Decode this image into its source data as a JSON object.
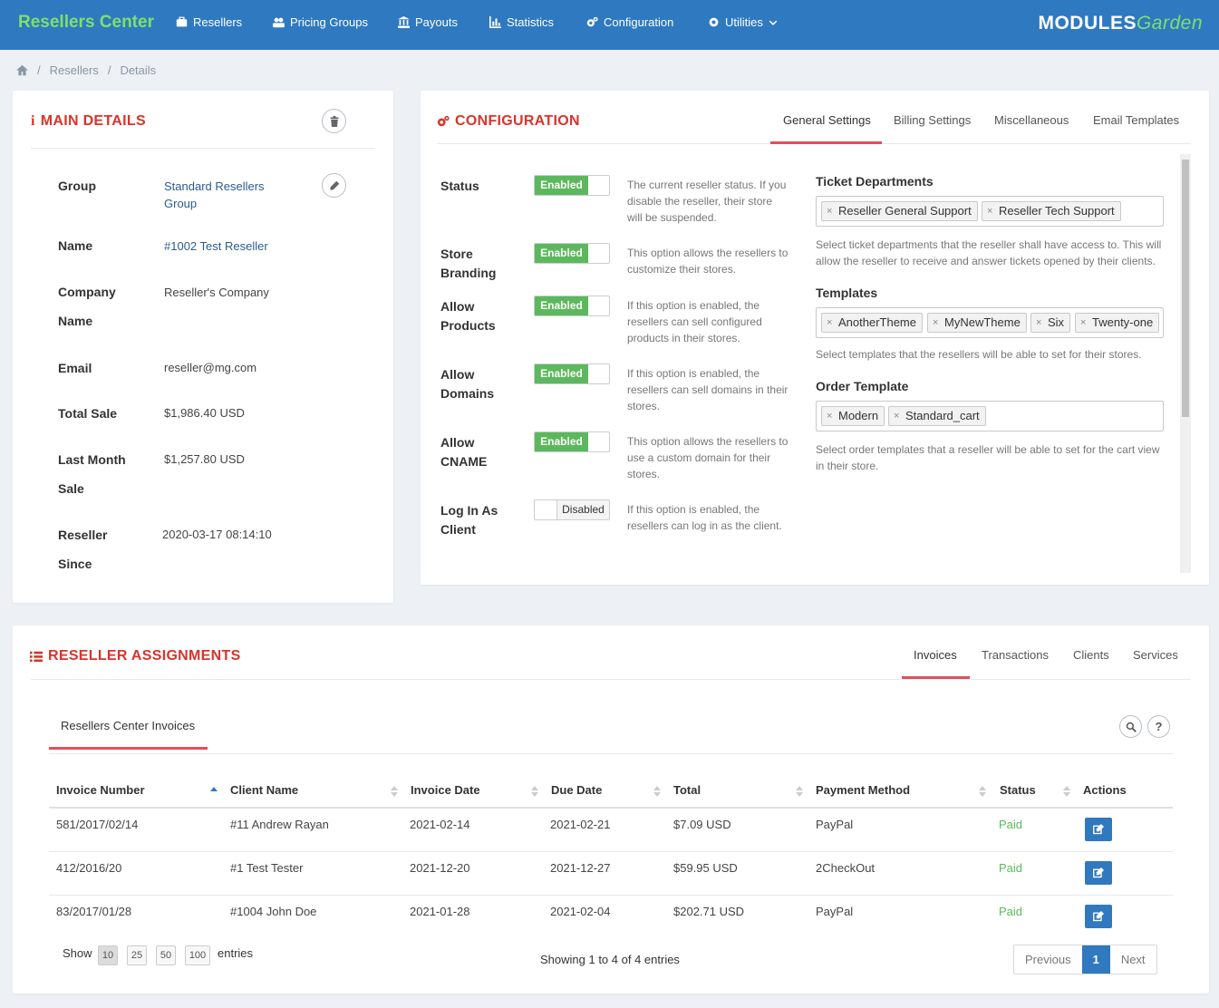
{
  "nav": {
    "brand": "Resellers Center",
    "items": [
      {
        "label": "Resellers",
        "icon": "briefcase-icon"
      },
      {
        "label": "Pricing Groups",
        "icon": "users-icon"
      },
      {
        "label": "Payouts",
        "icon": "bank-icon"
      },
      {
        "label": "Statistics",
        "icon": "bar-chart-icon"
      },
      {
        "label": "Configuration",
        "icon": "gears-icon"
      },
      {
        "label": "Utilities",
        "icon": "gear-icon"
      }
    ],
    "logo_left": "MODULES",
    "logo_right": "Garden"
  },
  "breadcrumb": [
    "Resellers",
    "Details"
  ],
  "main_details": {
    "title": "MAIN DETAILS",
    "fields": [
      {
        "label": "Group",
        "value": "Standard Resellers Group"
      },
      {
        "label": "Name",
        "value": "#1002 Test Reseller"
      },
      {
        "label": "Company Name",
        "value": "Reseller's Company"
      },
      {
        "label": "Email",
        "value": "reseller@mg.com"
      },
      {
        "label": "Total Sale",
        "value": "$1,986.40 USD"
      },
      {
        "label": "Last Month Sale",
        "value": "$1,257.80 USD"
      },
      {
        "label": "Reseller Since",
        "value": "2020-03-17 08:14:10"
      }
    ]
  },
  "configuration": {
    "title": "CONFIGURATION",
    "tabs": [
      "General Settings",
      "Billing Settings",
      "Miscellaneous",
      "Email Templates"
    ],
    "active_tab": "General Settings",
    "options": [
      {
        "label": "Status",
        "state": "Enabled",
        "description": "The current reseller status. If you disable the reseller, their store will be suspended."
      },
      {
        "label": "Store Branding",
        "state": "Enabled",
        "description": "This option allows the resellers to customize their stores."
      },
      {
        "label": "Allow Products",
        "state": "Enabled",
        "description": "If this option is enabled, the resellers can sell configured products in their stores."
      },
      {
        "label": "Allow Domains",
        "state": "Enabled",
        "description": "If this option is enabled, the resellers can sell domains in their stores."
      },
      {
        "label": "Allow CNAME",
        "state": "Enabled",
        "description": "This option allows the resellers to use a custom domain for their stores."
      },
      {
        "label": "Log In As Client",
        "state": "Disabled",
        "description": "If this option is enabled, the resellers can log in as the client."
      }
    ],
    "ticket_departments": {
      "heading": "Ticket Departments",
      "tags": [
        "Reseller General Support",
        "Reseller Tech Support"
      ],
      "help": "Select ticket departments that the reseller shall have access to. This will allow the reseller to receive and answer tickets opened by their clients."
    },
    "templates": {
      "heading": "Templates",
      "tags": [
        "AnotherTheme",
        "MyNewTheme",
        "Six",
        "Twenty-one"
      ],
      "help": "Select templates that the resellers will be able to set for their stores."
    },
    "order_template": {
      "heading": "Order Template",
      "tags": [
        "Modern",
        "Standard_cart"
      ],
      "help": "Select order templates that a reseller will be able to set for the cart view in their store."
    }
  },
  "assignments": {
    "title": "RESELLER ASSIGNMENTS",
    "tabs": [
      "Invoices",
      "Transactions",
      "Clients",
      "Services"
    ],
    "active_tab": "Invoices",
    "subtab": "Resellers Center Invoices",
    "columns": [
      "Invoice Number",
      "Client Name",
      "Invoice Date",
      "Due Date",
      "Total",
      "Payment Method",
      "Status",
      "Actions"
    ],
    "rows": [
      {
        "invoice": "581/2017/02/14",
        "client": "#11 Andrew Rayan",
        "date": "2021-02-14",
        "due": "2021-02-21",
        "total": "$7.09 USD",
        "method": "PayPal",
        "status": "Paid"
      },
      {
        "invoice": "412/2016/20",
        "client": "#1 Test Tester",
        "date": "2021-12-20",
        "due": "2021-12-27",
        "total": "$59.95 USD",
        "method": "2CheckOut",
        "status": "Paid"
      },
      {
        "invoice": "83/2017/01/28",
        "client": "#1004 John Doe",
        "date": "2021-01-28",
        "due": "2021-02-04",
        "total": "$202.71 USD",
        "method": "PayPal",
        "status": "Paid"
      }
    ],
    "show_label": "Show",
    "page_sizes": [
      "10",
      "25",
      "50",
      "100"
    ],
    "entries_label": "entries",
    "showing": "Showing 1 to 4 of 4 entries",
    "pager": {
      "previous": "Previous",
      "current": "1",
      "next": "Next"
    }
  },
  "colors": {
    "nav": "#2f79c1",
    "brand": "#7ee06b",
    "accent": "#d9342b",
    "enabled": "#5cb85c",
    "link": "#2a5d8e"
  }
}
